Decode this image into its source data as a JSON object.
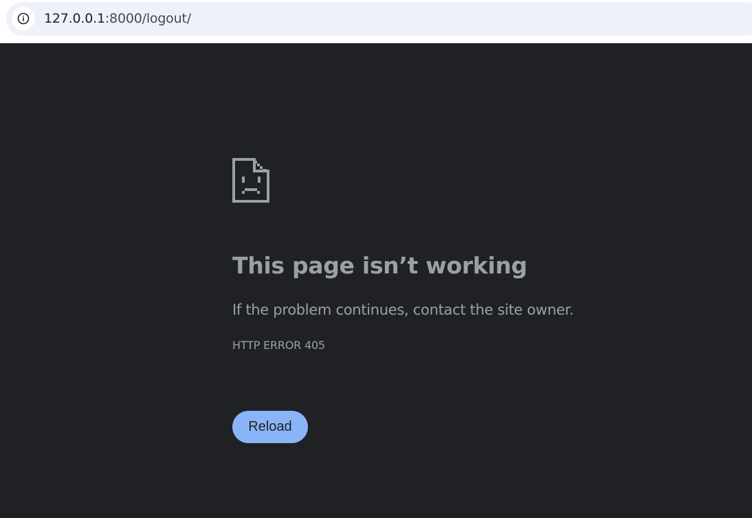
{
  "browser": {
    "address_bar": {
      "host": "127.0.0.1",
      "rest": ":8000/logout/",
      "site_info_icon": "info-circle-icon"
    }
  },
  "error_page": {
    "icon": "sad-page-icon",
    "title": "This page isn’t working",
    "description": "If the problem continues, contact the site owner.",
    "error_code": "HTTP ERROR 405",
    "reload_label": "Reload"
  },
  "colors": {
    "background": "#202124",
    "text": "#9aa0a6",
    "button": "#8ab4f8",
    "omnibox": "#edf2fa"
  }
}
